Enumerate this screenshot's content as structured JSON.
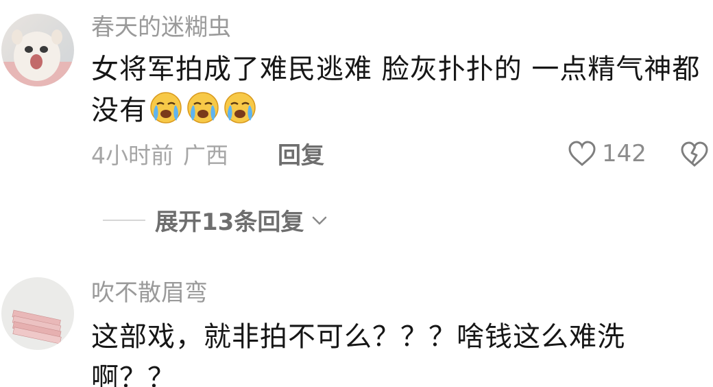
{
  "comments": [
    {
      "username": "春天的迷糊虫",
      "text": "女将军拍成了难民逃难  脸灰扑扑的 一点精气神都没有",
      "emojis": [
        "loudly-crying-face-icon",
        "loudly-crying-face-icon",
        "loudly-crying-face-icon"
      ],
      "time": "4小时前",
      "location": "广西",
      "reply_label": "回复",
      "like_count": "142",
      "expand_label": "展开13条回复"
    },
    {
      "username": "吹不散眉弯",
      "text": "这部戏，就非拍不可么？？？啥钱这么难洗啊？？"
    }
  ],
  "colors": {
    "text": "#161616",
    "username": "#9a9a9a",
    "meta": "#a6a6a6",
    "action": "#6e6e6e"
  }
}
